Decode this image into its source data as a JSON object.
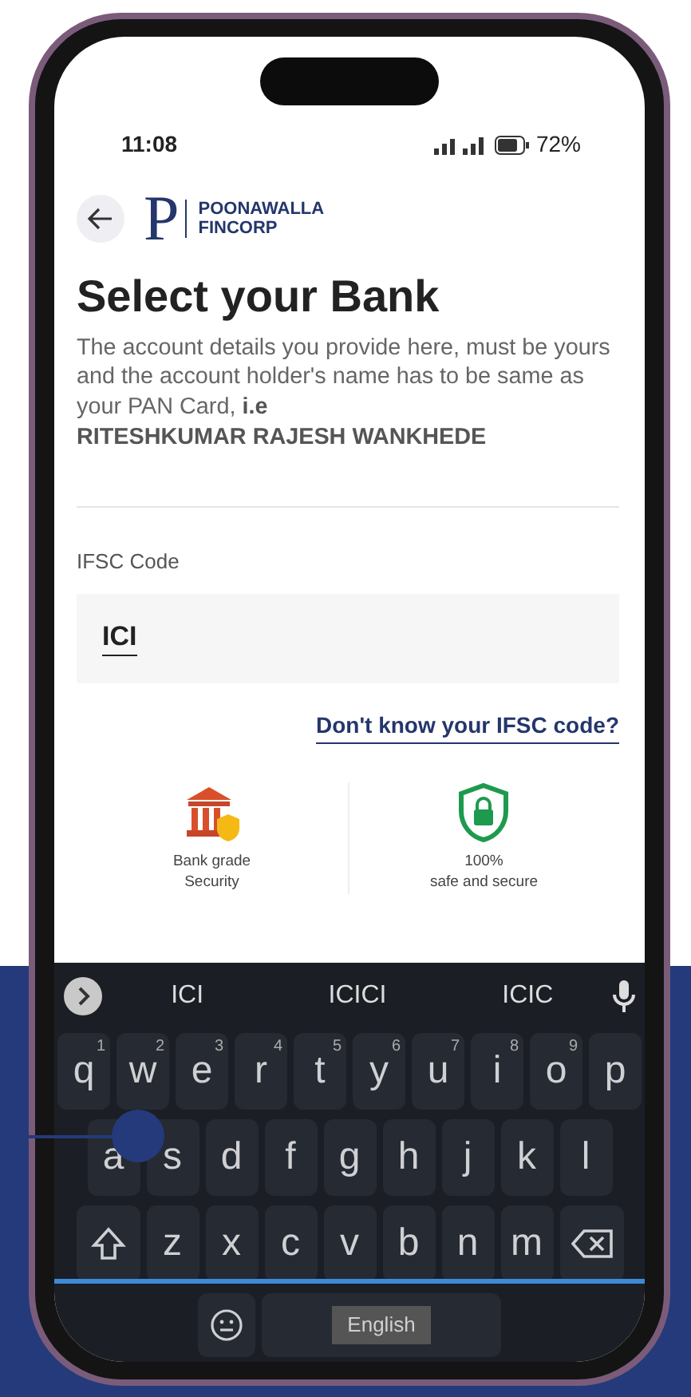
{
  "status_bar": {
    "time": "11:08",
    "battery": "72%"
  },
  "header": {
    "logo_letter": "P",
    "brand_lines": [
      "POONAWALLA",
      "FINCORP"
    ]
  },
  "title": "Select your Bank",
  "description": "The account details you provide here, must be yours and the account holder's name has to be same as your PAN Card, **i.e**\n**RITESHKUMAR RAJESH WANKHEDE**",
  "ifsc": {
    "label": "IFSC Code",
    "value": "ICI"
  },
  "help_link": "Don't know your IFSC code?",
  "badges": [
    {
      "kind": "bank",
      "text": "Bank grade\nSecurity"
    },
    {
      "kind": "shield",
      "text": "100%\nsafe and secure"
    }
  ],
  "keyboard": {
    "suggestions": [
      "ICI",
      "ICICI",
      "ICIC"
    ],
    "rows": [
      [
        {
          "key": "q",
          "hint": "1"
        },
        {
          "key": "w",
          "hint": "2"
        },
        {
          "key": "e",
          "hint": "3"
        },
        {
          "key": "r",
          "hint": "4"
        },
        {
          "key": "t",
          "hint": "5"
        },
        {
          "key": "y",
          "hint": "6"
        },
        {
          "key": "u",
          "hint": "7"
        },
        {
          "key": "i",
          "hint": "8"
        },
        {
          "key": "o",
          "hint": "9"
        },
        {
          "key": "p"
        }
      ],
      [
        {
          "key": "a"
        },
        {
          "key": "s"
        },
        {
          "key": "d"
        },
        {
          "key": "f"
        },
        {
          "key": "g"
        },
        {
          "key": "h"
        },
        {
          "key": "j"
        },
        {
          "key": "k"
        },
        {
          "key": "l"
        }
      ],
      [
        {
          "kind": "shift"
        },
        {
          "key": "z"
        },
        {
          "key": "x"
        },
        {
          "key": "c"
        },
        {
          "key": "v"
        },
        {
          "key": "b"
        },
        {
          "key": "n"
        },
        {
          "key": "m"
        },
        {
          "kind": "backspace"
        }
      ]
    ],
    "space_label": "English"
  }
}
